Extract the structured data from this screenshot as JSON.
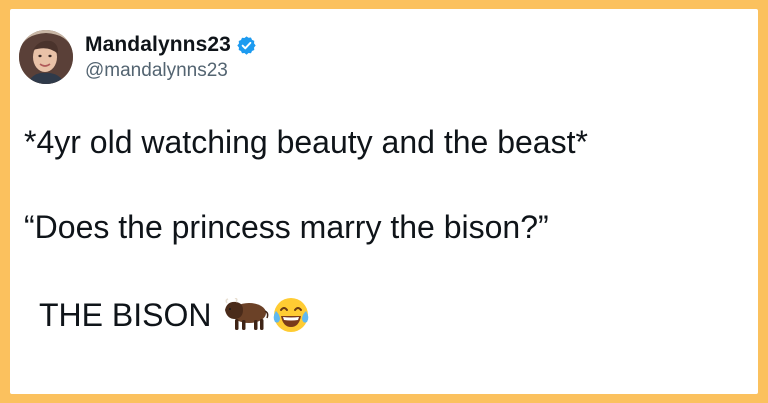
{
  "tweet": {
    "display_name": "Mandalynns23",
    "handle": "@mandalynns23",
    "verified": true,
    "lines": [
      "*4yr old watching beauty and the beast*",
      "“Does the princess marry the bison?”",
      "THE BISON"
    ],
    "emojis": [
      "bison-emoji",
      "tears-of-joy-emoji"
    ]
  },
  "colors": {
    "border": "#fbc15e",
    "card_bg": "#ffffff",
    "text": "#0f1419",
    "handle": "#536471",
    "verified_badge": "#1d9bf0"
  }
}
